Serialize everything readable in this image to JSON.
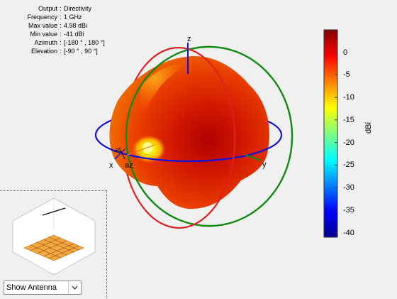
{
  "info": {
    "rows": [
      {
        "label": "Output",
        "value": "Directivity"
      },
      {
        "label": "Frequency",
        "value": "1 GHz"
      },
      {
        "label": "Max value",
        "value": "4.98 dBi"
      },
      {
        "label": "Min value",
        "value": "-41 dBi"
      },
      {
        "label": "Azimuth",
        "value": "[-180 ° , 180 °]"
      },
      {
        "label": "Elevation",
        "value": "[-90 ° , 90 °]"
      }
    ]
  },
  "axes": {
    "x": "x",
    "y": "y",
    "z": "z",
    "az": "az",
    "el": "el"
  },
  "colorbar": {
    "unit": "dBi",
    "ticks": [
      "0",
      "-5",
      "-10",
      "-15",
      "-20",
      "-25",
      "-30",
      "-35",
      "-40"
    ],
    "range": [
      -41,
      4.98
    ],
    "colormap": "jet"
  },
  "colors": {
    "x_ring": "#1010e0",
    "y_ring": "#108a10",
    "z_ring": "#e02020",
    "pattern_main": "#dc2c00",
    "background": "#f0f0f0"
  },
  "control": {
    "selected": "Show Antenna",
    "icon": "chevron-down-icon"
  }
}
